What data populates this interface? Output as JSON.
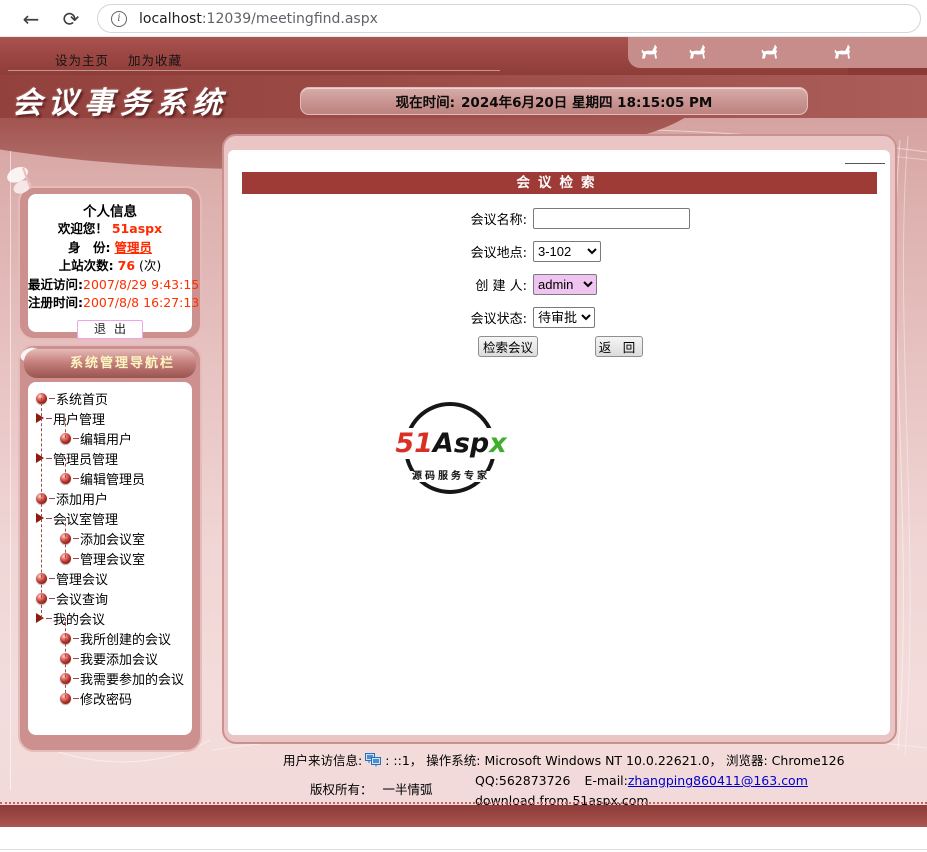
{
  "browser": {
    "url_host": "localhost",
    "url_rest": ":12039/meetingfind.aspx",
    "icons": {
      "back": "←",
      "refresh": "⟳",
      "info": "i"
    }
  },
  "topbar": {
    "set_home_label": "设为主页",
    "add_favorite_label": "加为收藏",
    "horse_icons": [
      "horse-icon",
      "horse-icon",
      "horse-icon",
      "horse-icon"
    ]
  },
  "header": {
    "site_title": "会议事务系统",
    "time_label": "现在时间:",
    "time_value": "2024年6月20日 星期四 18:15:05 PM"
  },
  "profile": {
    "title": "个人信息",
    "welcome_label": "欢迎您！",
    "username": "51aspx",
    "role_label": "身　份:",
    "role": "管理员",
    "visits_label": "上站次数:",
    "visits": "76",
    "visits_unit": "(次)",
    "last_visit_label": "最近访问:",
    "last_visit": "2007/8/29 9:43:15",
    "register_label": "注册时间:",
    "register": "2007/8/8 16:27:13",
    "logout_label": "退出"
  },
  "nav": {
    "title": "系统管理导航栏",
    "items": [
      {
        "label": "系统首页",
        "icon": "ball",
        "level": 0
      },
      {
        "label": "用户管理",
        "icon": "triangle",
        "level": 0
      },
      {
        "label": "编辑用户",
        "icon": "ball",
        "level": 1
      },
      {
        "label": "管理员管理",
        "icon": "triangle",
        "level": 0
      },
      {
        "label": "编辑管理员",
        "icon": "ball",
        "level": 1
      },
      {
        "label": "添加用户",
        "icon": "ball",
        "level": 0
      },
      {
        "label": "会议室管理",
        "icon": "triangle",
        "level": 0
      },
      {
        "label": "添加会议室",
        "icon": "ball",
        "level": 1
      },
      {
        "label": "管理会议室",
        "icon": "ball",
        "level": 1
      },
      {
        "label": "管理会议",
        "icon": "ball",
        "level": 0
      },
      {
        "label": "会议查询",
        "icon": "ball",
        "level": 0
      },
      {
        "label": "我的会议",
        "icon": "triangle",
        "level": 0
      },
      {
        "label": "我所创建的会议",
        "icon": "ball",
        "level": 1
      },
      {
        "label": "我要添加会议",
        "icon": "ball",
        "level": 1
      },
      {
        "label": "我需要参加的会议",
        "icon": "ball",
        "level": 1
      },
      {
        "label": "修改密码",
        "icon": "ball",
        "level": 1
      }
    ]
  },
  "search": {
    "title": "会议检索",
    "fields": [
      {
        "label": "会议名称:",
        "type": "text",
        "value": "",
        "name": "meeting-name-input",
        "width_class": ""
      },
      {
        "label": "会议地点:",
        "type": "select",
        "value": "3-102",
        "name": "location-select",
        "width_class": "w1",
        "highlight": false
      },
      {
        "label": "创 建 人:",
        "type": "select",
        "value": "admin",
        "name": "creator-select",
        "width_class": "w2",
        "highlight": true
      },
      {
        "label": "会议状态:",
        "type": "select",
        "value": "待审批",
        "name": "status-select",
        "width_class": "w3",
        "highlight": false
      }
    ],
    "search_button": "检索会议",
    "back_button": "返 回"
  },
  "logo": {
    "part_51": "51",
    "part_asp": "Asp",
    "part_x": "x",
    "subtitle": "源码服务专家"
  },
  "footer": {
    "visit_label": "用户来访信息:",
    "visit_value": ": ::1， 操作系统: Microsoft Windows NT 10.0.22621.0， 浏览器: Chrome126",
    "copyright_label": "版权所有：",
    "copyright_value": "一半情弧",
    "qq": "QQ:562873726",
    "email_label": "E-mail:",
    "email": "zhangping860411@163.com",
    "download_text": "download from 51aspx.com"
  },
  "colors": {
    "band_red": "#9c4743",
    "title_bar_red": "#9e3b37",
    "panel_frame_pink": "#cc908e",
    "page_pink": "#e7c3c2",
    "nav_title_yellow": "#fcf5c0",
    "value_red": "#ff2a00",
    "highlight_select": "#f0c4f0",
    "link_blue": "#0000cc",
    "logo_red": "#d93025",
    "logo_green": "#3fae2a"
  }
}
